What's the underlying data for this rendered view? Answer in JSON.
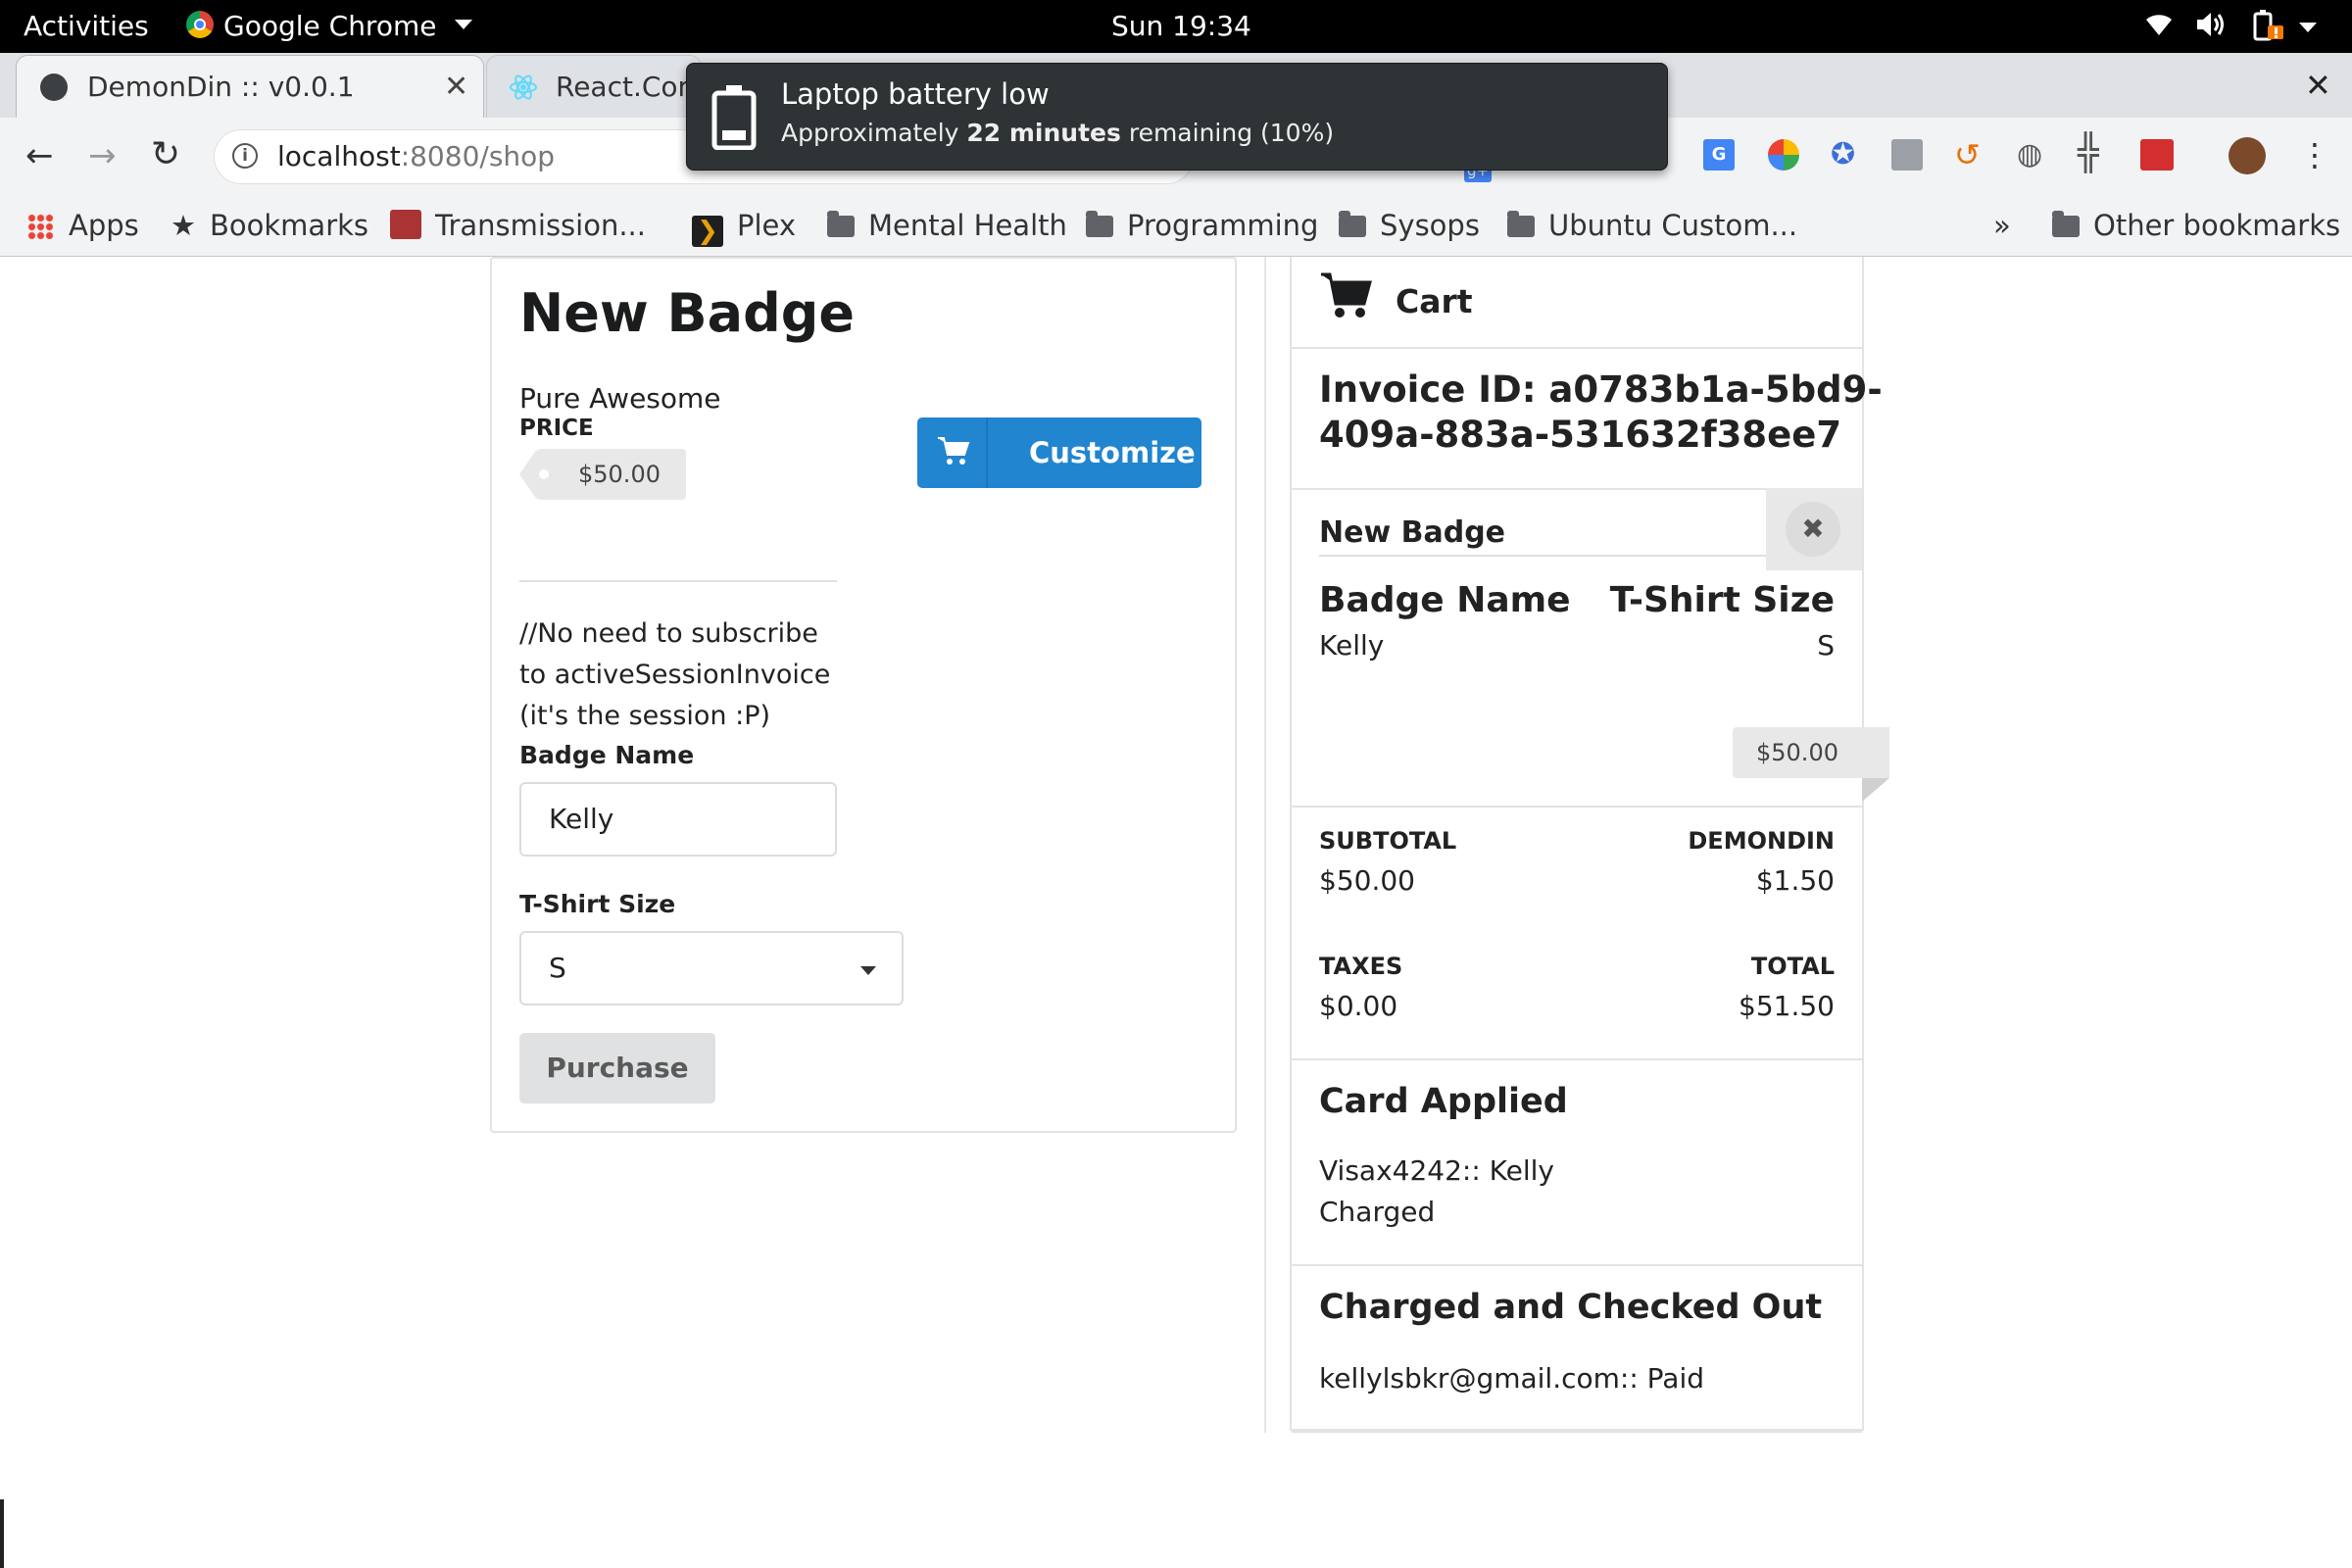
{
  "topbar": {
    "activities": "Activities",
    "app_name": "Google Chrome",
    "clock": "Sun 19:34"
  },
  "tabs": [
    {
      "title": "DemonDin :: v0.0.1",
      "active": true
    },
    {
      "title": "React.Com",
      "active": false
    }
  ],
  "toolbar": {
    "url_host": "localhost",
    "url_path": ":8080/shop"
  },
  "bookmarks": {
    "items": [
      "Apps",
      "Bookmarks",
      "Transmission...",
      "Plex",
      "Mental Health",
      "Programming",
      "Sysops",
      "Ubuntu Custom..."
    ],
    "overflow": "»",
    "other": "Other bookmarks"
  },
  "notification": {
    "title": "Laptop battery low",
    "body_prefix": "Approximately ",
    "body_bold": "22 minutes",
    "body_suffix": " remaining (10%)"
  },
  "product": {
    "title": "New Badge",
    "description": "Pure Awesome",
    "price_label": "PRICE",
    "price": "$50.00",
    "customize_label": "Customize",
    "comment": "//No need to subscribe to activeSessionInvoice (it's the session :P)",
    "badge_name_label": "Badge Name",
    "badge_name_value": "Kelly",
    "tshirt_label": "T-Shirt Size",
    "tshirt_value": "S",
    "purchase_label": "Purchase"
  },
  "cart": {
    "header": "Cart",
    "invoice_line1": "Invoice ID: a0783b1a-5bd9-",
    "invoice_line2": "409a-883a-531632f38ee7",
    "item": {
      "name": "New Badge",
      "col1_header": "Badge Name",
      "col1_value": "Kelly",
      "col2_header": "T-Shirt Size",
      "col2_value": "S",
      "price": "$50.00"
    },
    "subtotal_label": "SUBTOTAL",
    "subtotal_value": "$50.00",
    "demondin_label": "DEMONDIN",
    "demondin_value": "$1.50",
    "taxes_label": "TAXES",
    "taxes_value": "$0.00",
    "total_label": "TOTAL",
    "total_value": "$51.50",
    "card_title": "Card Applied",
    "card_line1": "Visax4242:: Kelly",
    "card_line2": "Charged",
    "checkout_title": "Charged and Checked Out",
    "checkout_line": "kellylsbkr@gmail.com:: Paid"
  }
}
